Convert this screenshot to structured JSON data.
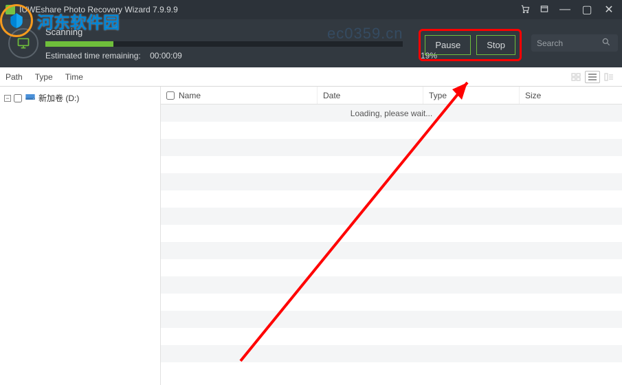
{
  "title": "IUWEshare Photo Recovery Wizard 7.9.9.9",
  "scan": {
    "status_label": "Scanning",
    "progress_pct": 19,
    "progress_pct_text": "19%",
    "est_label": "Estimated time remaining:",
    "est_value": "00:00:09",
    "pause_label": "Pause",
    "stop_label": "Stop",
    "search_placeholder": "Search"
  },
  "filters": {
    "path": "Path",
    "type": "Type",
    "time": "Time"
  },
  "tree": {
    "root_label": "新加卷 (D:)"
  },
  "columns": {
    "name": "Name",
    "date": "Date",
    "type": "Type",
    "size": "Size"
  },
  "list": {
    "loading_text": "Loading, please wait..."
  },
  "watermark": {
    "text": "河东软件园",
    "url": "ec0359.cn"
  },
  "colors": {
    "accent_green": "#6fbf3b",
    "header_bg": "#323940",
    "highlight_red": "#ff0000"
  }
}
